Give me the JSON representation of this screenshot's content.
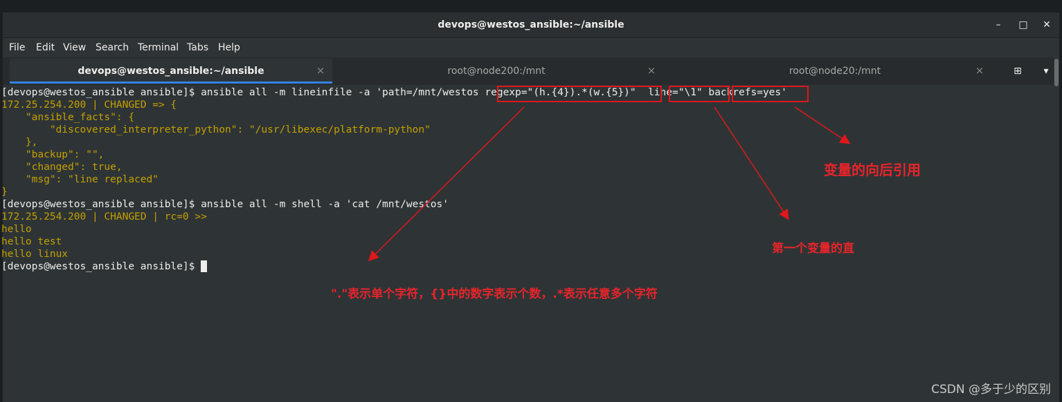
{
  "window": {
    "title": "devops@westos_ansible:~/ansible"
  },
  "window_controls": {
    "minimize": "–",
    "maximize": "□",
    "close": "✕"
  },
  "menubar": {
    "items": [
      "File",
      "Edit",
      "View",
      "Search",
      "Terminal",
      "Tabs",
      "Help"
    ]
  },
  "tabs": [
    {
      "label": "devops@westos_ansible:~/ansible",
      "active": true
    },
    {
      "label": "root@node200:/mnt",
      "active": false
    },
    {
      "label": "root@node20:/mnt",
      "active": false
    }
  ],
  "tab_close": "×",
  "tabbar_tools": {
    "new_tab_icon": "⊞",
    "menu_icon": "▾"
  },
  "terminal": {
    "lines": [
      {
        "text": "[devops@westos_ansible ansible]$ ansible all -m lineinfile -a 'path=/mnt/westos regexp=\"(h.{4}).*(w.{5})\"  line=\"\\1\" backrefs=yes'",
        "color": "white"
      },
      {
        "text": "172.25.254.200 | CHANGED => {",
        "color": "yellow"
      },
      {
        "text": "    \"ansible_facts\": {",
        "color": "yellow"
      },
      {
        "text": "        \"discovered_interpreter_python\": \"/usr/libexec/platform-python\"",
        "color": "yellow"
      },
      {
        "text": "    },",
        "color": "yellow"
      },
      {
        "text": "    \"backup\": \"\",",
        "color": "yellow"
      },
      {
        "text": "    \"changed\": true,",
        "color": "yellow"
      },
      {
        "text": "    \"msg\": \"line replaced\"",
        "color": "yellow"
      },
      {
        "text": "}",
        "color": "yellow"
      },
      {
        "text": "[devops@westos_ansible ansible]$ ansible all -m shell -a 'cat /mnt/westos'",
        "color": "white"
      },
      {
        "text": "172.25.254.200 | CHANGED | rc=0 >>",
        "color": "yellow"
      },
      {
        "text": "hello",
        "color": "yellow"
      },
      {
        "text": "hello test",
        "color": "yellow"
      },
      {
        "text": "hello linux",
        "color": "yellow"
      },
      {
        "text": "[devops@westos_ansible ansible]$ ",
        "color": "white"
      }
    ]
  },
  "annotations": {
    "backrefs_note": "变量的向后引用",
    "line_note": "第一个变量的直",
    "regexp_note": "\".\"表示单个字符，{}中的数字表示个数，.*表示任意多个字符"
  },
  "watermark": "CSDN @多于少的区别",
  "colors": {
    "annotation_red": "#e0171b",
    "output_yellow": "#c4a000",
    "text_white": "#eeeeec",
    "background": "#2e3436"
  }
}
